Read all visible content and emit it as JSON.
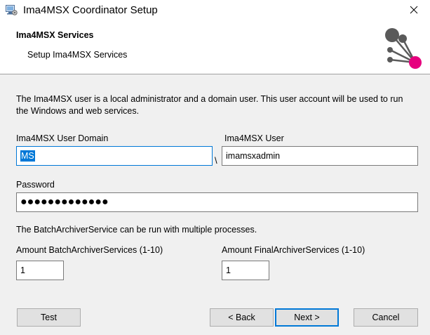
{
  "window": {
    "title": "Ima4MSX Coordinator Setup",
    "app_icon": "setup-computer-icon",
    "close_icon": "close-icon"
  },
  "banner": {
    "title": "Ima4MSX Services",
    "subtitle": "Setup Ima4MSX Services",
    "logo": "molecule-logo",
    "logo_colors": {
      "gray": "#5a5a5a",
      "accent": "#e6007e"
    }
  },
  "form": {
    "description": "The Ima4MSX user is a local administrator and a domain user. This user account will be used to run the Windows and web services.",
    "domain_label": "Ima4MSX User Domain",
    "domain_value": "MS",
    "separator": "\\",
    "user_label": "Ima4MSX User",
    "user_value": "imamsxadmin",
    "password_label": "Password",
    "password_value": "●●●●●●●●●●●●●",
    "batch_note": "The BatchArchiverService can be run with multiple processes.",
    "batch_label": "Amount BatchArchiverServices (1-10)",
    "batch_value": "1",
    "final_label": "Amount FinalArchiverServices (1-10)",
    "final_value": "1"
  },
  "footer": {
    "test_label": "Test",
    "back_label": "< Back",
    "next_label": "Next >",
    "cancel_label": "Cancel"
  },
  "colors": {
    "focus": "#0078d7",
    "panel": "#f0f0f0",
    "button": "#e1e1e1"
  }
}
